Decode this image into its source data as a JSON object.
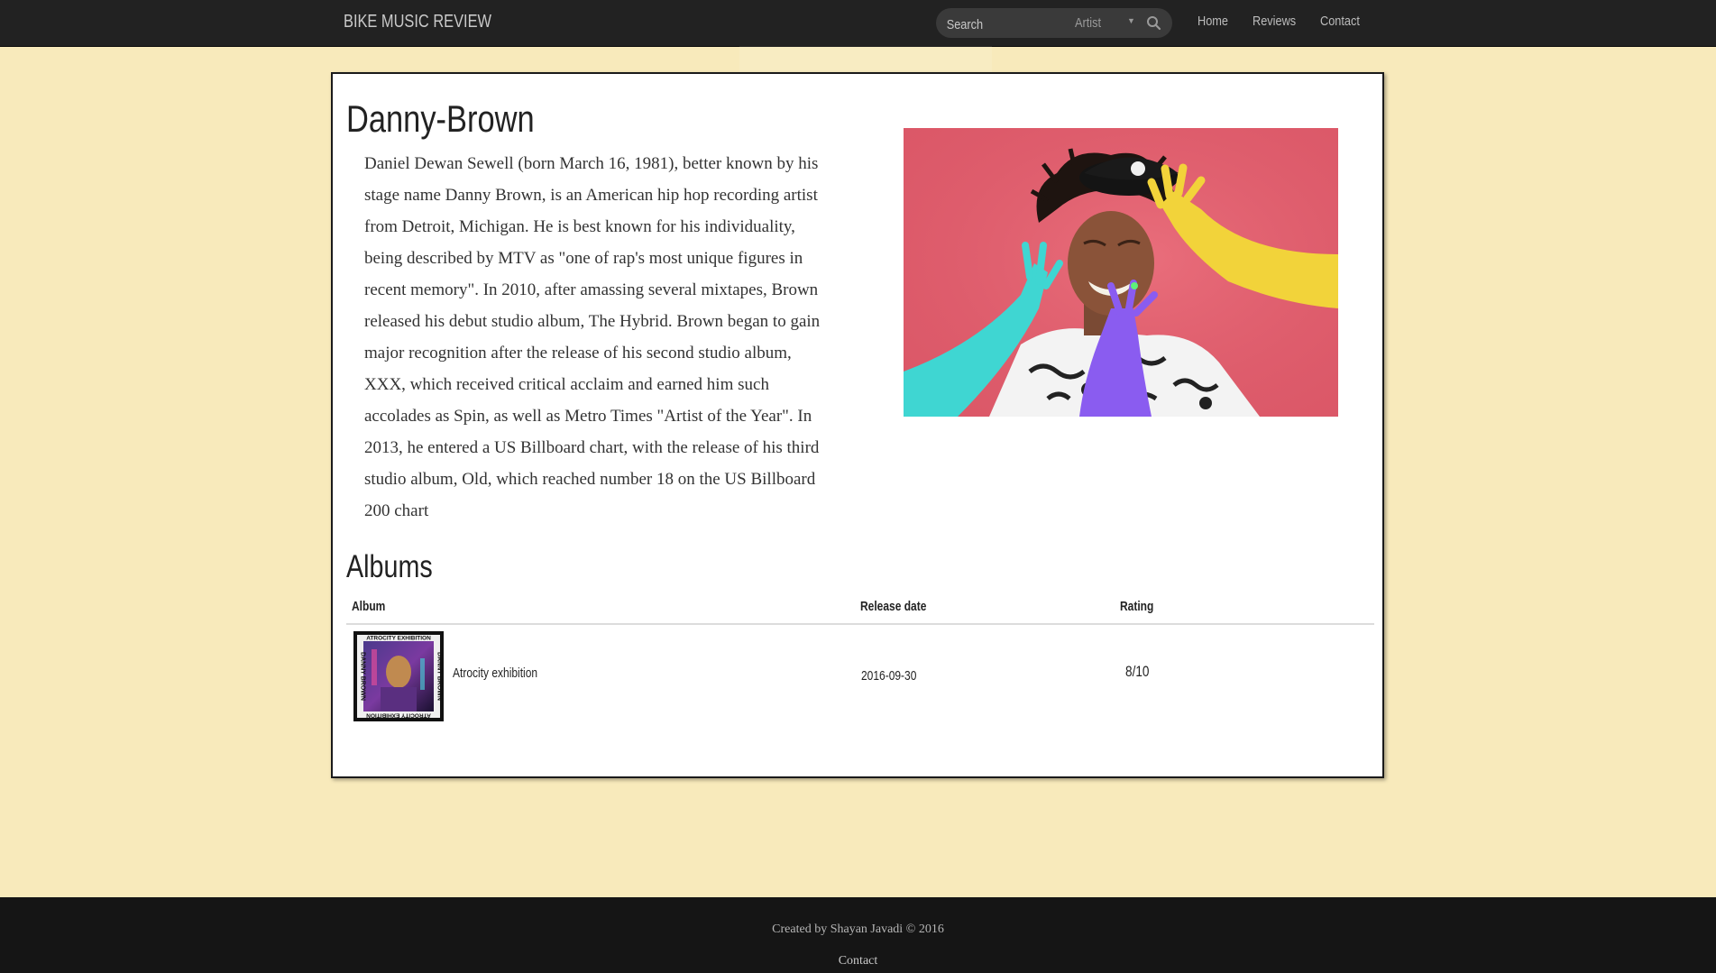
{
  "navbar": {
    "brand": "BIKE MUSIC REVIEW",
    "search": {
      "placeholder": "Search",
      "type_selected": "Artist"
    },
    "links": [
      "Home",
      "Reviews",
      "Contact"
    ]
  },
  "artist": {
    "name": "Danny-Brown",
    "bio": "Daniel Dewan Sewell (born March 16, 1981), better known by his stage name Danny Brown, is an American hip hop recording artist from Detroit, Michigan. He is best known for his individuality, being described by MTV as \"one of rap's most unique figures in recent memory\". In 2010, after amassing several mixtapes, Brown released his debut studio album, The Hybrid. Brown began to gain major recognition after the release of his second studio album, XXX, which received critical acclaim and earned him such accolades as Spin, as well as Metro Times \"Artist of the Year\". In 2013, he entered a US Billboard chart, with the release of his third studio album, Old, which reached number 18 on the US Billboard 200 chart"
  },
  "albums": {
    "title": "Albums",
    "columns": [
      "Album",
      "Release date",
      "Rating"
    ],
    "rows": [
      {
        "name": "Atrocity exhibition",
        "release_date": "2016-09-30",
        "rating": "8/10",
        "cover_text": "ATROCITY EXHIBITION",
        "cover_artist_text": "DANNY BROWN"
      }
    ]
  },
  "footer": {
    "credit": "Created by Shayan Javadi © 2016",
    "contact": "Contact"
  },
  "colors": {
    "page_bg": "#f8eabb",
    "navbar_bg": "#222222",
    "footer_bg": "#151515",
    "photo_bg": "#e05c6c"
  },
  "icons": [
    "search-icon",
    "dropdown-caret-icon"
  ]
}
